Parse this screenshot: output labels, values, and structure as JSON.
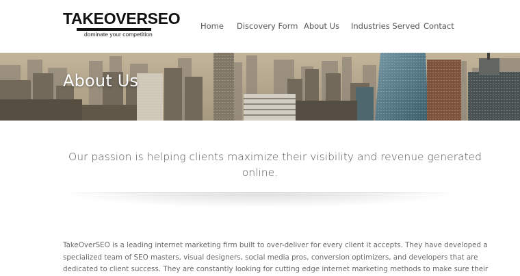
{
  "logo": {
    "name": "TAKEOVERSEO",
    "tagline": "dominate your competition"
  },
  "nav": {
    "items": [
      {
        "label": "Home"
      },
      {
        "label": "Discovery Form"
      },
      {
        "label": "About Us"
      },
      {
        "label": "Industries Served"
      },
      {
        "label": "Contact"
      }
    ]
  },
  "hero": {
    "title": "About Us",
    "image": "city-skyline-photo"
  },
  "intro": {
    "tagline_line1": "Our passion is helping clients maximize their visibility and revenue generated",
    "tagline_line2": "online."
  },
  "about": {
    "lines": [
      "TakeOverSEO is a leading internet marketing firm built to over-deliver for every client it accepts. They have developed a",
      "specialized team of SEO masters, visual designers, social media pros, conversion optimizers, and developers that are",
      "dedicated to client success. They are constantly looking for cutting edge internet marketing methods to make sure their"
    ]
  },
  "colors": {
    "nav_text": "#555555",
    "body_text": "#6a6a6a",
    "logo": "#111111",
    "hero_title": "#ffffff"
  }
}
